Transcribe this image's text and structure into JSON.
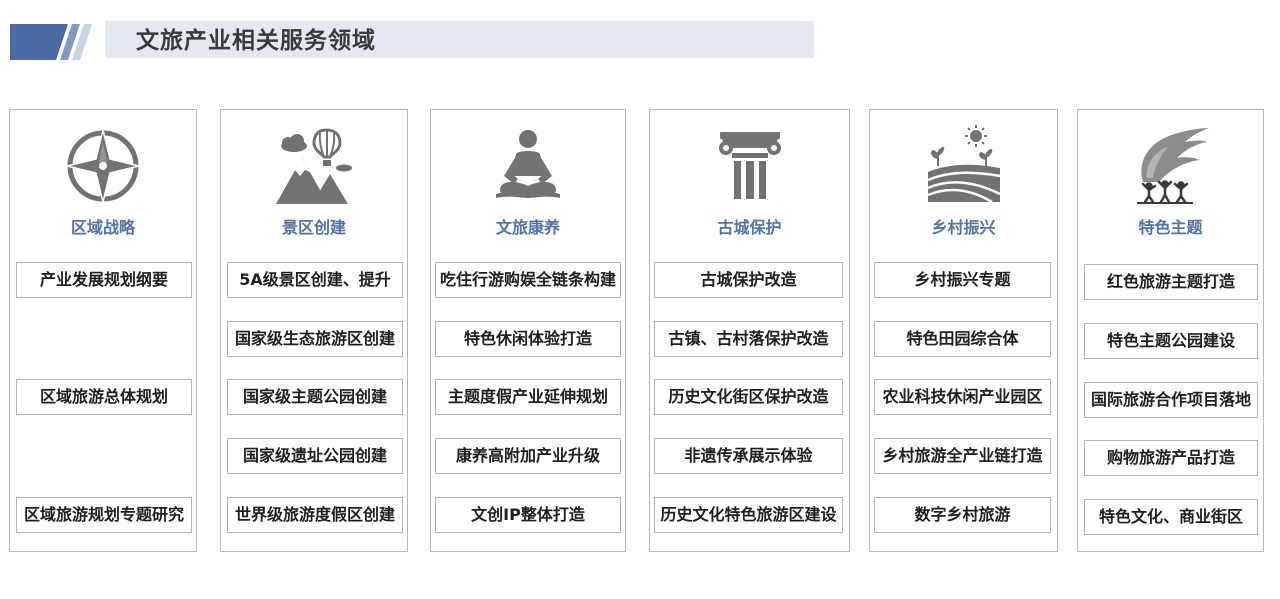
{
  "header": {
    "title": "文旅产业相关服务领域"
  },
  "colors": {
    "accent": "#4a6aa5",
    "icon_gray": "#727272",
    "column_title": "#5073a6",
    "header_bar": "#e3e8f1"
  },
  "columns": [
    {
      "title": "区域战略",
      "icon": "compass-icon",
      "items": [
        "产业发展规划纲要",
        "区域旅游总体规划",
        "区域旅游规划专题研究"
      ]
    },
    {
      "title": "景区创建",
      "icon": "mountain-balloon-icon",
      "items": [
        "5A级景区创建、提升",
        "国家级生态旅游区创建",
        "国家级主题公园创建",
        "国家级遗址公园创建",
        "世界级旅游度假区创建"
      ]
    },
    {
      "title": "文旅康养",
      "icon": "meditation-icon",
      "items": [
        "吃住行游购娱全链条构建",
        "特色休闲体验打造",
        "主题度假产业延伸规划",
        "康养高附加产业升级",
        "文创IP整体打造"
      ]
    },
    {
      "title": "古城保护",
      "icon": "column-pillar-icon",
      "items": [
        "古城保护改造",
        "古镇、古村落保护改造",
        "历史文化街区保护改造",
        "非遗传承展示体验",
        "历史文化特色旅游区建设"
      ]
    },
    {
      "title": "乡村振兴",
      "icon": "farmland-sun-icon",
      "items": [
        "乡村振兴专题",
        "特色田园综合体",
        "农业科技休闲产业园区",
        "乡村旅游全产业链打造",
        "数字乡村旅游"
      ]
    },
    {
      "title": "特色主题",
      "icon": "torch-people-icon",
      "items": [
        "红色旅游主题打造",
        "特色主题公园建设",
        "国际旅游合作项目落地",
        "购物旅游产品打造",
        "特色文化、商业街区"
      ]
    }
  ]
}
